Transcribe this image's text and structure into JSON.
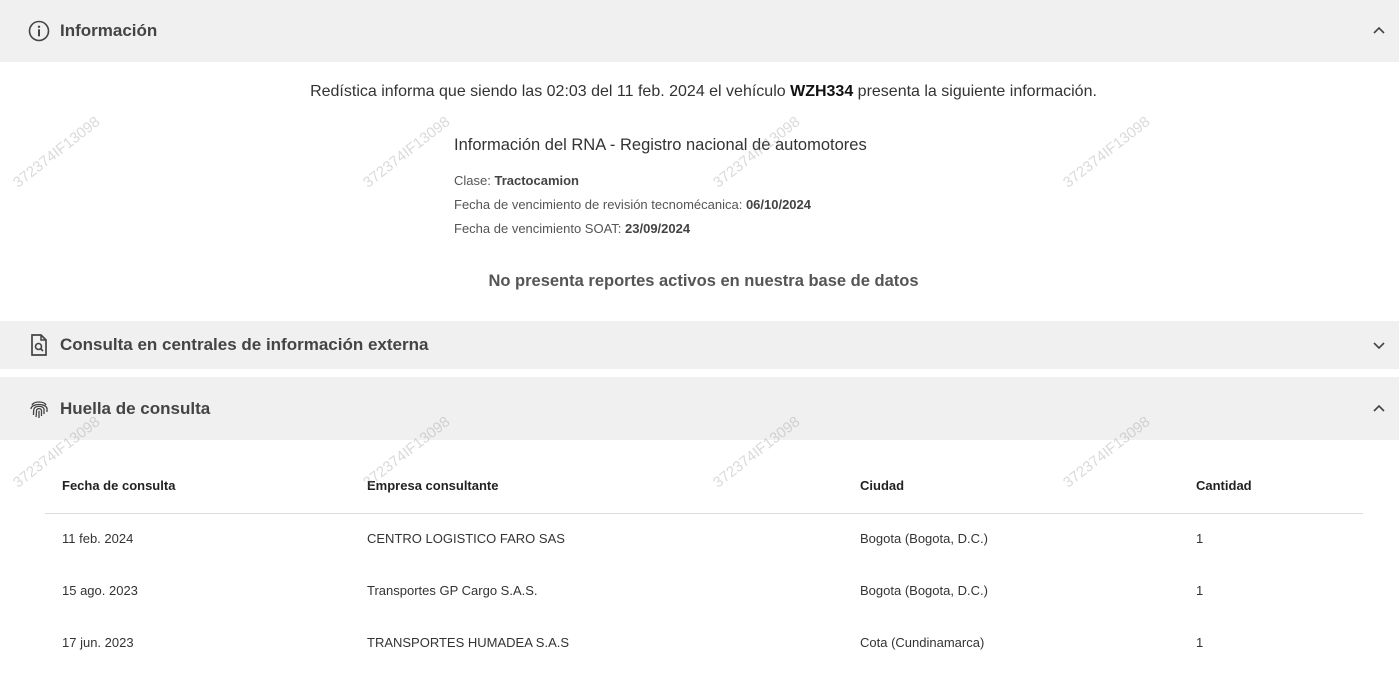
{
  "info_panel": {
    "title": "Información",
    "intro_prefix": "Redística informa que siendo las 02:03 del 11 feb. 2024 el vehículo ",
    "plate": "WZH334",
    "intro_suffix": " presenta la siguiente información.",
    "rna_title": "Información del RNA - Registro nacional de automotores",
    "clase_label": "Clase: ",
    "clase_value": "Tractocamion",
    "tecno_label": "Fecha de vencimiento de revisión tecnomécanica: ",
    "tecno_value": "06/10/2024",
    "soat_label": "Fecha de vencimiento SOAT: ",
    "soat_value": "23/09/2024",
    "no_reports": "No presenta reportes activos en nuestra base de datos"
  },
  "external_panel": {
    "title": "Consulta en centrales de información externa"
  },
  "huella_panel": {
    "title": "Huella de consulta",
    "columns": [
      "Fecha de consulta",
      "Empresa consultante",
      "Ciudad",
      "Cantidad"
    ],
    "rows": [
      [
        "11 feb. 2024",
        "CENTRO LOGISTICO FARO SAS",
        "Bogota (Bogota, D.C.)",
        "1"
      ],
      [
        "15 ago. 2023",
        "Transportes GP Cargo S.A.S.",
        "Bogota (Bogota, D.C.)",
        "1"
      ],
      [
        "17 jun. 2023",
        "TRANSPORTES HUMADEA S.A.S",
        "Cota (Cundinamarca)",
        "1"
      ]
    ]
  },
  "watermark": "372374IF13098",
  "icons": {
    "info": "info-circle-icon",
    "external": "document-search-icon",
    "huella": "fingerprint-icon",
    "expand": "chevron-up-icon",
    "collapse": "chevron-down-icon"
  }
}
